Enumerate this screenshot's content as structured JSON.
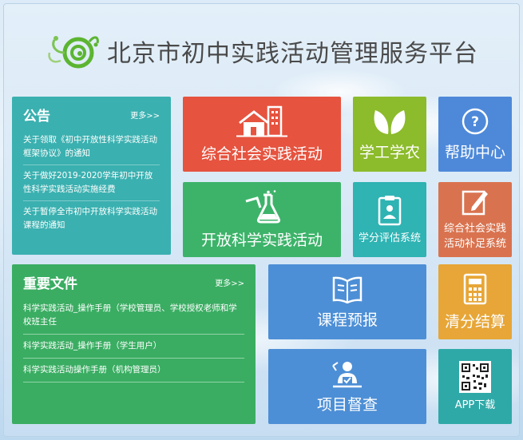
{
  "header": {
    "title": "北京市初中实践活动管理服务平台",
    "logo_icon": "swirl-logo-icon"
  },
  "announcements": {
    "title": "公告",
    "more": "更多>>",
    "items": [
      "关于领取《初中开放性科学实践活动框架协议》的通知",
      "关于做好2019-2020学年初中开放性科学实践活动实施经费",
      "关于暂停全市初中开放科学实践活动课程的通知"
    ]
  },
  "documents": {
    "title": "重要文件",
    "more": "更多>>",
    "items": [
      "科学实践活动_操作手册（学校管理员、学校授权老师和学校班主任",
      "科学实践活动_操作手册（学生用户）",
      "科学实践活动操作手册（机构管理员）"
    ]
  },
  "tiles": {
    "social": {
      "label": "综合社会实践活动",
      "icon": "building-icon",
      "color": "#e6533f"
    },
    "agri": {
      "label": "学工学农",
      "icon": "leaf-icon",
      "color": "#8cbb2b"
    },
    "help": {
      "label": "帮助中心",
      "icon": "question-icon",
      "color": "#4e89d9"
    },
    "science": {
      "label": "开放科学实践活动",
      "icon": "flask-icon",
      "color": "#3db36a"
    },
    "credit": {
      "label": "学分评估系统",
      "icon": "clipboard-icon",
      "color": "#2fb3b3"
    },
    "supplement": {
      "label": "综合社会实践活动补足系统",
      "label_line1": "综合社会实践",
      "label_line2": "活动补足系统",
      "icon": "edit-icon",
      "color": "#d9734f"
    },
    "course": {
      "label": "课程预报",
      "icon": "book-icon",
      "color": "#4d8fd6"
    },
    "settle": {
      "label": "清分结算",
      "icon": "calculator-icon",
      "color": "#e7a637"
    },
    "supervise": {
      "label": "项目督查",
      "icon": "inspector-icon",
      "color": "#4d8fd6"
    },
    "app": {
      "label": "APP下载",
      "icon": "qr-code-icon",
      "color": "#2fa9a8"
    }
  },
  "colors": {
    "announce_bg": "#3bb0b0",
    "docs_bg": "#3aad62",
    "title_text": "#4a4a4a",
    "logo_green": "#5cb531"
  }
}
